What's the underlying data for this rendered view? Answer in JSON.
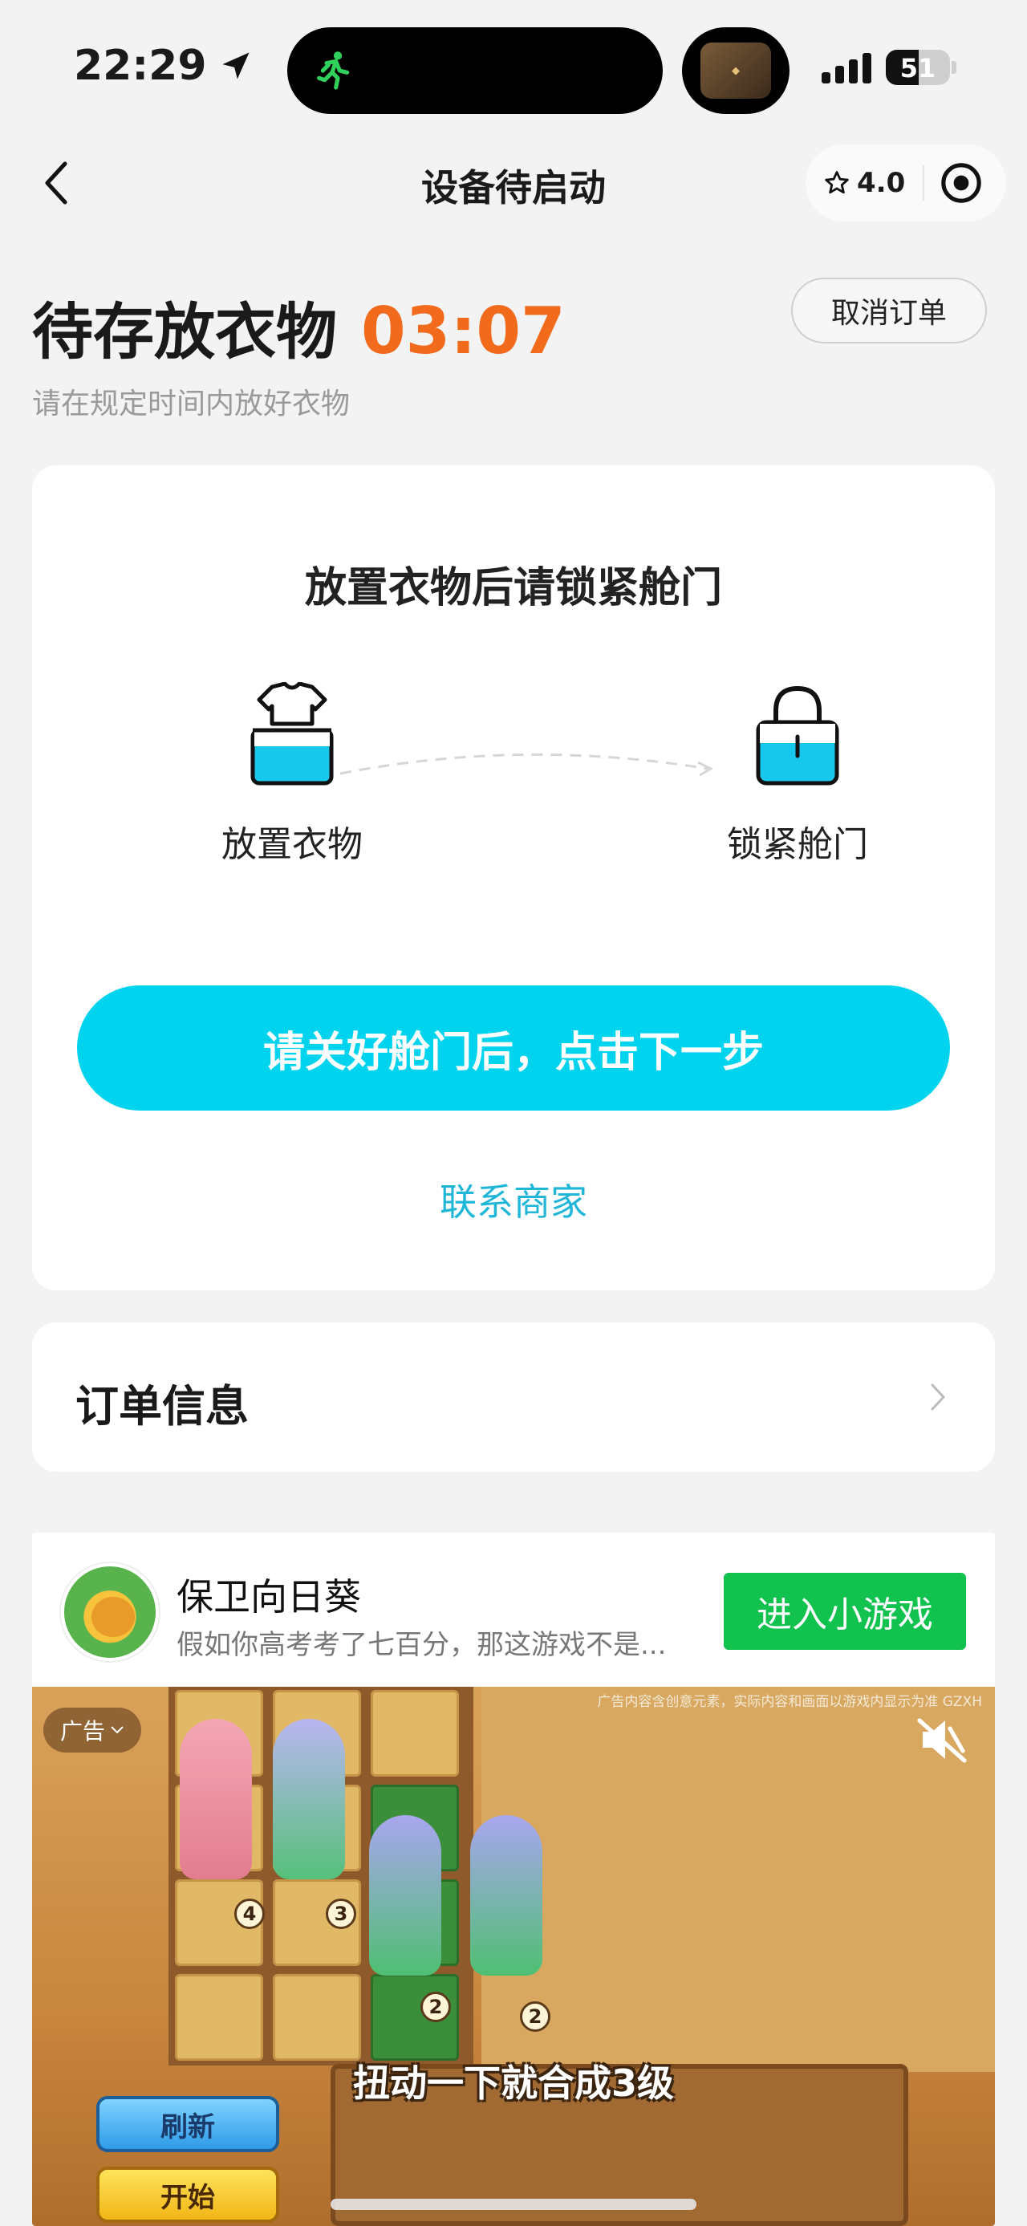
{
  "status_bar": {
    "time": "22:29",
    "battery": "51",
    "battery_level": 0.51
  },
  "nav": {
    "title": "设备待启动",
    "rating": "4.0"
  },
  "header": {
    "status": "待存放衣物",
    "countdown": "03:07",
    "cancel_label": "取消订单",
    "subtitle": "请在规定时间内放好衣物"
  },
  "card": {
    "title": "放置衣物后请锁紧舱门",
    "steps": [
      {
        "label": "放置衣物",
        "icon": "tshirt-box-icon"
      },
      {
        "label": "锁紧舱门",
        "icon": "lock-icon"
      }
    ],
    "primary_label": "请关好舱门后，点击下一步",
    "contact_label": "联系商家"
  },
  "order": {
    "title": "订单信息"
  },
  "ad": {
    "app_name": "保卫向日葵",
    "description": "假如你高考考了七百分，那这游戏不是...",
    "cta_label": "进入小游戏",
    "badge": "广告",
    "disclaimer": "广告内容含创意元素，实际内容和画面以游戏内显示为准  GZXH",
    "caption": "扭动一下就合成3级",
    "refresh_label": "刷新",
    "start_label": "开始",
    "levels": [
      "4",
      "3",
      "2",
      "2"
    ]
  },
  "colors": {
    "accent": "#00d3ee",
    "countdown": "#f26a1b",
    "link": "#1fb6d8",
    "cta_green": "#12c24f"
  }
}
